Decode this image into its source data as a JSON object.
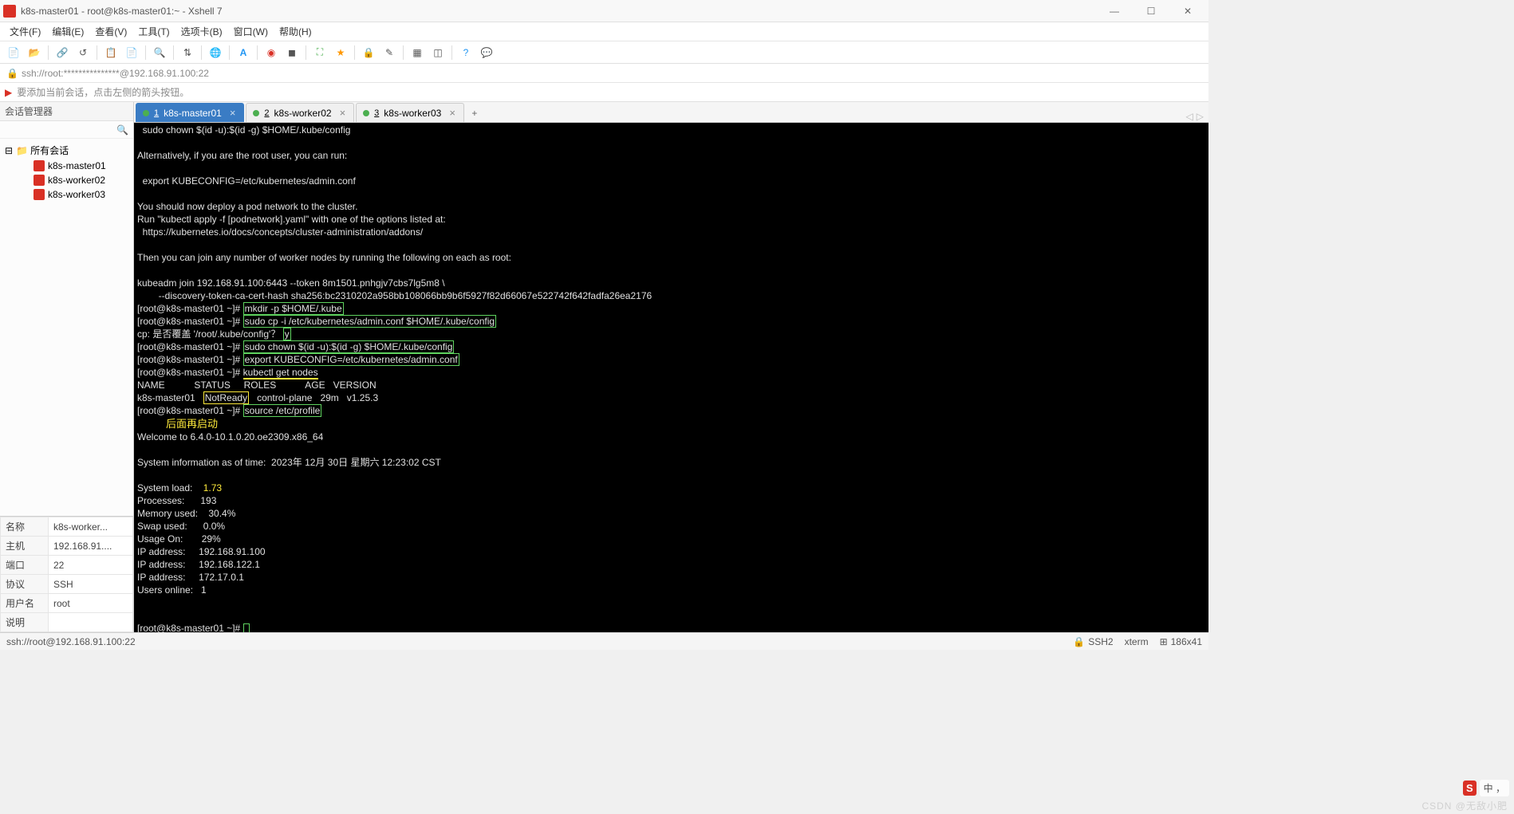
{
  "window": {
    "title": "k8s-master01 - root@k8s-master01:~ - Xshell 7"
  },
  "menu": {
    "file": "文件(F)",
    "edit": "编辑(E)",
    "view": "查看(V)",
    "tools": "工具(T)",
    "tabs": "选项卡(B)",
    "window": "窗口(W)",
    "help": "帮助(H)"
  },
  "addressbar": {
    "text": "ssh://root:***************@192.168.91.100:22"
  },
  "hint": {
    "text": "要添加当前会话，点击左侧的箭头按钮。"
  },
  "sidebar": {
    "title": "会话管理器",
    "root": "所有会话",
    "items": [
      {
        "label": "k8s-master01"
      },
      {
        "label": "k8s-worker02"
      },
      {
        "label": "k8s-worker03"
      }
    ]
  },
  "props": {
    "rows": [
      {
        "k": "名称",
        "v": "k8s-worker..."
      },
      {
        "k": "主机",
        "v": "192.168.91...."
      },
      {
        "k": "端口",
        "v": "22"
      },
      {
        "k": "协议",
        "v": "SSH"
      },
      {
        "k": "用户名",
        "v": "root"
      },
      {
        "k": "说明",
        "v": ""
      }
    ]
  },
  "tabs": {
    "items": [
      {
        "num": "1",
        "label": "k8s-master01",
        "active": true
      },
      {
        "num": "2",
        "label": "k8s-worker02",
        "active": false
      },
      {
        "num": "3",
        "label": "k8s-worker03",
        "active": false
      }
    ]
  },
  "terminal": {
    "l01": "  sudo chown $(id -u):$(id -g) $HOME/.kube/config",
    "l02": "",
    "l03": "Alternatively, if you are the root user, you can run:",
    "l04": "",
    "l05": "  export KUBECONFIG=/etc/kubernetes/admin.conf",
    "l06": "",
    "l07": "You should now deploy a pod network to the cluster.",
    "l08": "Run \"kubectl apply -f [podnetwork].yaml\" with one of the options listed at:",
    "l09": "  https://kubernetes.io/docs/concepts/cluster-administration/addons/",
    "l10": "",
    "l11": "Then you can join any number of worker nodes by running the following on each as root:",
    "l12": "",
    "l13": "kubeadm join 192.168.91.100:6443 --token 8m1501.pnhgjv7cbs7lg5m8 \\",
    "l14": "        --discovery-token-ca-cert-hash sha256:bc2310202a958bb108066bb9b6f5927f82d66067e522742f642fadfa26ea2176",
    "p1": "[root@k8s-master01 ~]# ",
    "c1": "mkdir -p $HOME/.kube",
    "c2": "sudo cp -i /etc/kubernetes/admin.conf $HOME/.kube/config",
    "l15a": "cp: 是否覆盖 '/root/.kube/config'？ ",
    "l15b": "y",
    "c3": "sudo chown $(id -u):$(id -g) $HOME/.kube/config",
    "c4": "export KUBECONFIG=/etc/kubernetes/admin.conf",
    "c5": "kubectl get nodes",
    "hdr": "NAME           STATUS     ROLES           AGE   VERSION",
    "row1a": "k8s-master01   ",
    "row1b": "NotReady",
    "row1c": "   control-plane   29m   v1.25.3",
    "c6": "source /etc/profile",
    "annot": "后面再启动",
    "l20": "Welcome to 6.4.0-10.1.0.20.oe2309.x86_64",
    "l21": "",
    "l22": "System information as of time:  2023年 12月 30日 星期六 12:23:02 CST",
    "l23": "",
    "s_load_k": "System load:    ",
    "s_load_v": "1.73",
    "s_proc": "Processes:      193",
    "s_mem": "Memory used:    30.4%",
    "s_swap": "Swap used:      0.0%",
    "s_usage": "Usage On:       29%",
    "s_ip1": "IP address:     192.168.91.100",
    "s_ip2": "IP address:     192.168.122.1",
    "s_ip3": "IP address:     172.17.0.1",
    "s_users": "Users online:   1",
    "blank": ""
  },
  "status": {
    "left": "ssh://root@192.168.91.100:22",
    "ssh": "SSH2",
    "term": "xterm",
    "size": "186x41"
  },
  "ime": {
    "badge": "S",
    "text": "中 ，"
  },
  "watermark": "CSDN @无敌小肥"
}
